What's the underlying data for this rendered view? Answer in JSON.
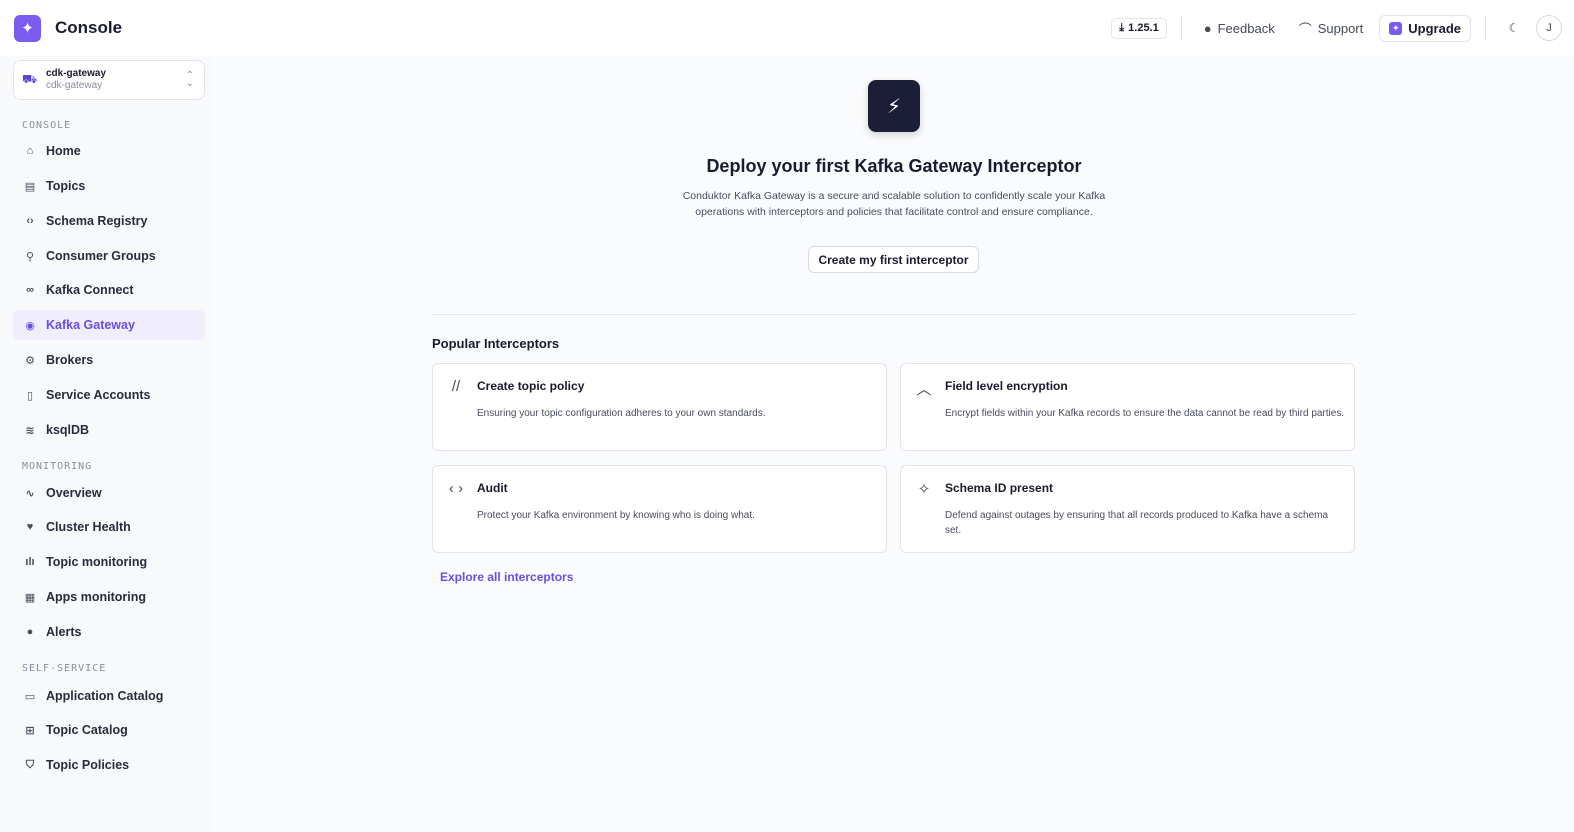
{
  "header": {
    "app_title": "Console",
    "version": "1.25.1",
    "feedback_label": "Feedback",
    "support_label": "Support",
    "upgrade_label": "Upgrade",
    "avatar_initial": "J"
  },
  "cluster": {
    "name": "cdk-gateway",
    "subtitle": "cdk-gateway"
  },
  "sidebar": {
    "sections": [
      {
        "label": "CONSOLE"
      },
      {
        "label": "MONITORING"
      },
      {
        "label": "SELF-SERVICE"
      }
    ],
    "items": [
      {
        "label": "Home",
        "icon": "home-icon"
      },
      {
        "label": "Topics",
        "icon": "topics-icon"
      },
      {
        "label": "Schema Registry",
        "icon": "code-icon"
      },
      {
        "label": "Consumer Groups",
        "icon": "hierarchy-icon"
      },
      {
        "label": "Kafka Connect",
        "icon": "link-icon"
      },
      {
        "label": "Kafka Gateway",
        "icon": "gateway-icon",
        "active": true
      },
      {
        "label": "Brokers",
        "icon": "broker-icon"
      },
      {
        "label": "Service Accounts",
        "icon": "account-icon"
      },
      {
        "label": "ksqlDB",
        "icon": "database-icon"
      },
      {
        "label": "Overview",
        "icon": "pulse-icon"
      },
      {
        "label": "Cluster Health",
        "icon": "heart-icon"
      },
      {
        "label": "Topic monitoring",
        "icon": "bar-chart-icon"
      },
      {
        "label": "Apps monitoring",
        "icon": "apps-icon"
      },
      {
        "label": "Alerts",
        "icon": "alert-icon"
      },
      {
        "label": "Application Catalog",
        "icon": "catalog-icon"
      },
      {
        "label": "Topic Catalog",
        "icon": "grid-icon"
      },
      {
        "label": "Topic Policies",
        "icon": "shield-icon"
      }
    ]
  },
  "hero": {
    "title": "Deploy your first Kafka Gateway Interceptor",
    "description": "Conduktor Kafka Gateway is a secure and scalable solution to confidently scale your Kafka operations with interceptors and policies that facilitate control and ensure compliance.",
    "button_label": "Create my first interceptor"
  },
  "popular": {
    "title": "Popular Interceptors",
    "cards": [
      {
        "title": "Create topic policy",
        "description": "Ensuring your topic configuration adheres to your own standards.",
        "icon": "double-slash-icon"
      },
      {
        "title": "Field level encryption",
        "description": "Encrypt fields within your Kafka records to ensure the data cannot be read by third parties.",
        "icon": "chevron-up-icon"
      },
      {
        "title": "Audit",
        "description": "Protect your Kafka environment by knowing who is doing what.",
        "icon": "code-brackets-icon"
      },
      {
        "title": "Schema ID present",
        "description": "Defend against outages by ensuring that all records produced to Kafka have a schema set.",
        "icon": "sparkle-icon"
      }
    ],
    "explore_label": "Explore all interceptors"
  },
  "colors": {
    "accent": "#7b5cf0",
    "active_text": "#6a4ee0",
    "hero_icon_bg": "#1b1e36"
  }
}
